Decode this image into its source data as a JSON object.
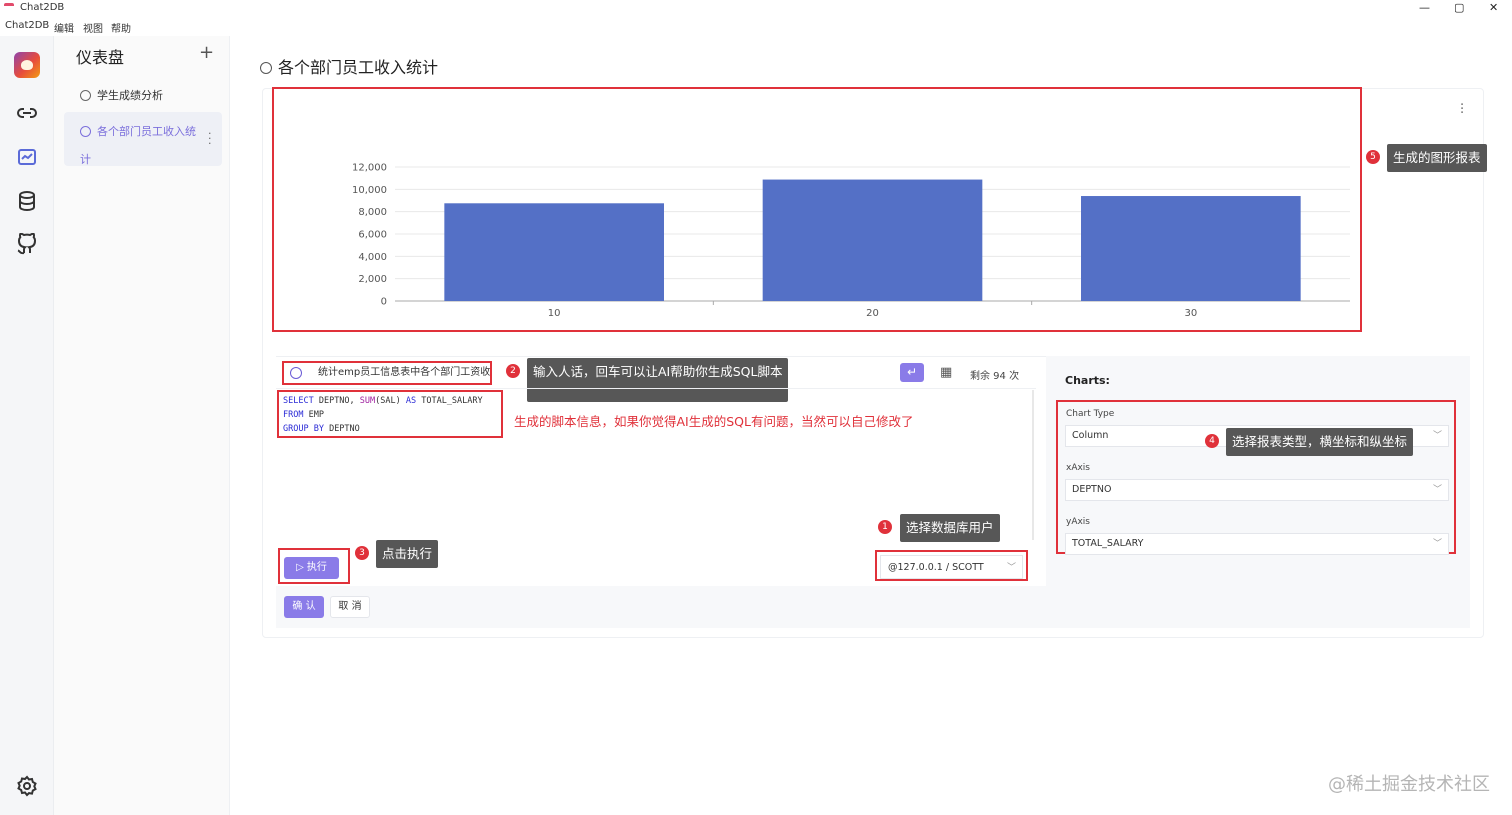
{
  "window": {
    "title": "Chat2DB",
    "controls": [
      "—",
      "▢",
      "✕"
    ]
  },
  "menu": [
    "Chat2DB",
    "编辑",
    "视图",
    "帮助"
  ],
  "rail": [
    "link-icon",
    "dashboard-icon",
    "database-icon",
    "github-icon",
    "settings-icon"
  ],
  "sidebar": {
    "title": "仪表盘",
    "add_label": "+",
    "items": [
      {
        "label": "学生成绩分析"
      },
      {
        "label": "各个部门员工收入统计"
      }
    ]
  },
  "page": {
    "title": "各个部门员工收入统计"
  },
  "chart_data": {
    "type": "bar",
    "categories": [
      "10",
      "20",
      "30"
    ],
    "values": [
      8750,
      10875,
      9400
    ],
    "ylim": [
      0,
      12000
    ],
    "yticks": [
      0,
      2000,
      4000,
      6000,
      8000,
      10000,
      12000
    ],
    "ytick_labels": [
      "0",
      "2,000",
      "4,000",
      "6,000",
      "8,000",
      "10,000",
      "12,000"
    ],
    "color": "#5470c6",
    "grid": true
  },
  "editor": {
    "prompt": "统计emp员工信息表中各个部门工资收入",
    "enter_label": "↵",
    "remaining": "剩余 94 次",
    "sql_lines": [
      [
        [
          "kw",
          "SELECT"
        ],
        [
          "t",
          " DEPTNO, "
        ],
        [
          "fn",
          "SUM"
        ],
        [
          "t",
          "(SAL) "
        ],
        [
          "kw",
          "AS"
        ],
        [
          "t",
          " TOTAL_SALARY"
        ]
      ],
      [
        [
          "kw",
          "FROM"
        ],
        [
          "t",
          " EMP"
        ]
      ],
      [
        [
          "kw",
          "GROUP BY"
        ],
        [
          "t",
          " DEPTNO"
        ]
      ]
    ],
    "exec_label": "▷ 执行",
    "db_user": "@127.0.0.1 / SCOTT"
  },
  "actions": {
    "ok": "确 认",
    "cancel": "取 消"
  },
  "config": {
    "title": "Charts:",
    "chart_type_label": "Chart Type",
    "chart_type_value": "Column",
    "xaxis_label": "xAxis",
    "xaxis_value": "DEPTNO",
    "yaxis_label": "yAxis",
    "yaxis_value": "TOTAL_SALARY"
  },
  "annotations": {
    "n1": "1",
    "t1": "选择数据库用户",
    "n2": "2",
    "t2": "输入人话，回车可以让AI帮助你生成SQL脚本",
    "n3": "3",
    "t3": "点击执行",
    "n4": "4",
    "t4": "选择报表类型，横坐标和纵坐标",
    "n5": "5",
    "t5": "生成的图形报表",
    "script_note": "生成的脚本信息，如果你觉得AI生成的SQL有问题，当然可以自己修改了"
  },
  "watermark": "@稀土掘金技术社区"
}
